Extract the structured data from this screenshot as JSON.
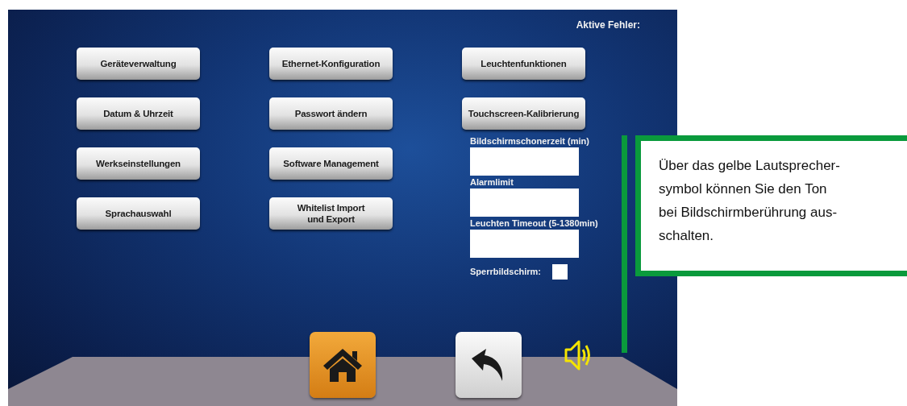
{
  "screen": {
    "errors_label": "Aktive Fehler:",
    "button_columns": [
      [
        "Geräteverwaltung",
        "Datum & Uhrzeit",
        "Werkseinstellungen",
        "Sprachauswahl"
      ],
      [
        "Ethernet-Konfiguration",
        "Passwort ändern",
        "Software Management",
        "Whitelist Import\nund Export"
      ],
      [
        "Leuchtenfunktionen",
        "Touchscreen-Kalibrierung"
      ]
    ],
    "settings": [
      {
        "kind": "field",
        "label": "Bildschirmschonerzeit (min)"
      },
      {
        "kind": "field",
        "label": "Alarmlimit"
      },
      {
        "kind": "field",
        "label": "Leuchten Timeout (5-1380min)"
      },
      {
        "kind": "checkbox",
        "label": "Sperrbildschirm:",
        "checked": false
      }
    ],
    "nav": [
      {
        "kind": "home"
      },
      {
        "kind": "back"
      },
      {
        "kind": "sound"
      }
    ]
  },
  "callout": {
    "text": "Über das gelbe Lautsprecher-\nsymbol können Sie den Ton\nbei Bildschirmberührung aus-\nschalten."
  }
}
